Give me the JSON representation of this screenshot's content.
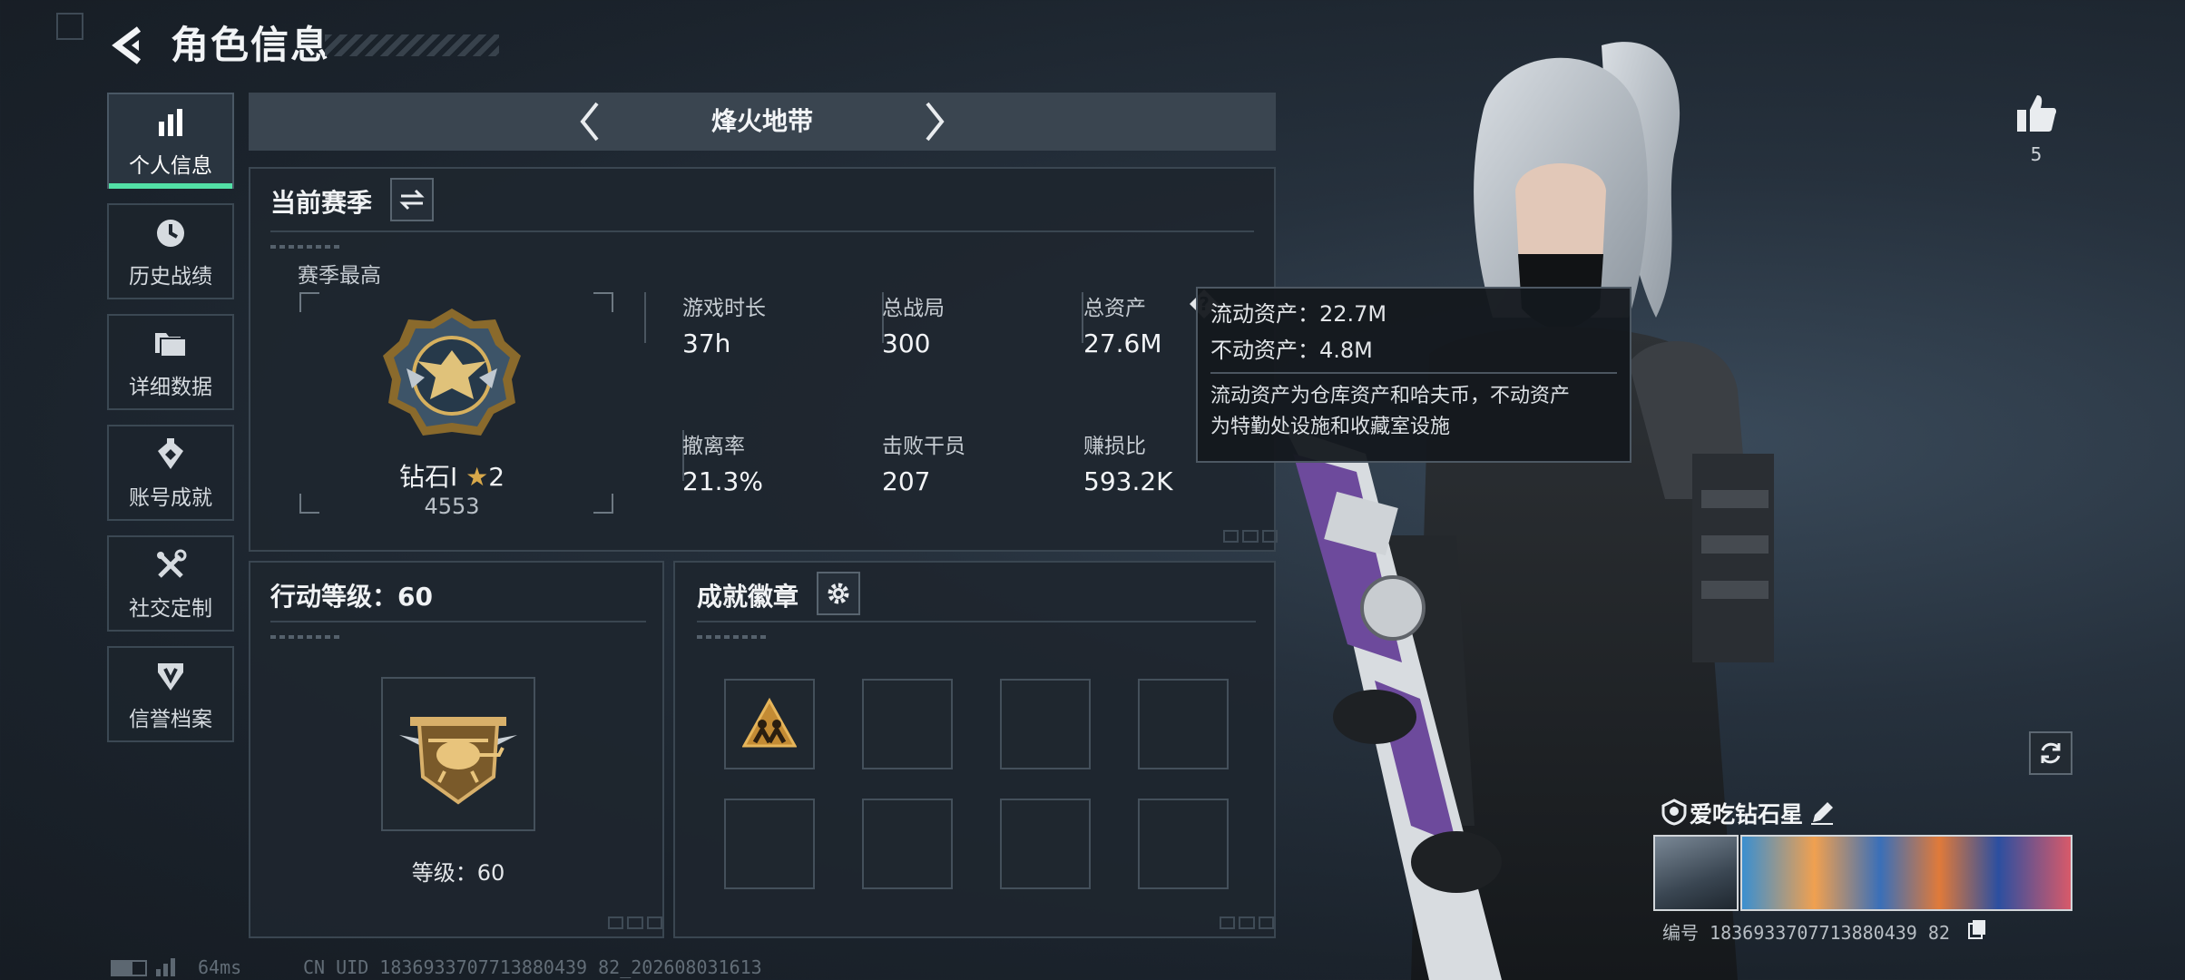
{
  "header": {
    "title": "角色信息"
  },
  "nav": {
    "items": [
      {
        "label": "个人信息",
        "icon": "bar-chart-icon",
        "active": true
      },
      {
        "label": "历史战绩",
        "icon": "clock-icon",
        "active": false
      },
      {
        "label": "详细数据",
        "icon": "folders-icon",
        "active": false
      },
      {
        "label": "账号成就",
        "icon": "achievement-icon",
        "active": false
      },
      {
        "label": "社交定制",
        "icon": "tools-icon",
        "active": false
      },
      {
        "label": "信誉档案",
        "icon": "credit-shield-icon",
        "active": false
      }
    ]
  },
  "mode": {
    "name": "烽火地带"
  },
  "season": {
    "title": "当前赛季",
    "peak_label": "赛季最高",
    "rank_name": "钻石I",
    "rank_stars": "2",
    "rank_score": "4553",
    "stats": [
      {
        "label": "游戏时长",
        "value": "37h"
      },
      {
        "label": "总战局",
        "value": "300"
      },
      {
        "label": "总资产",
        "value": "27.6M"
      },
      {
        "label": "撤离率",
        "value": "21.3%"
      },
      {
        "label": "击败干员",
        "value": "207"
      },
      {
        "label": "赚损比",
        "value": "593.2K"
      }
    ]
  },
  "tooltip": {
    "liquid": "流动资产：22.7M",
    "fixed": "不动资产：4.8M",
    "desc_1": "流动资产为仓库资产和哈夫币，不动资产",
    "desc_2": "为特勤处设施和收藏室设施"
  },
  "action_level": {
    "title": "行动等级：60",
    "level_text": "等级：60"
  },
  "badges": {
    "title": "成就徽章"
  },
  "likes": {
    "count": "5"
  },
  "player": {
    "name": "爱吃钻石星",
    "id_line": "编号 1836933707713880439 82"
  },
  "status": {
    "latency": "64ms",
    "uid_line": "CN UID 1836933707713880439 82_202608031613"
  },
  "colors": {
    "accent": "#52e0a6",
    "gold": "#d8a84a",
    "panel": "#1e262f"
  }
}
